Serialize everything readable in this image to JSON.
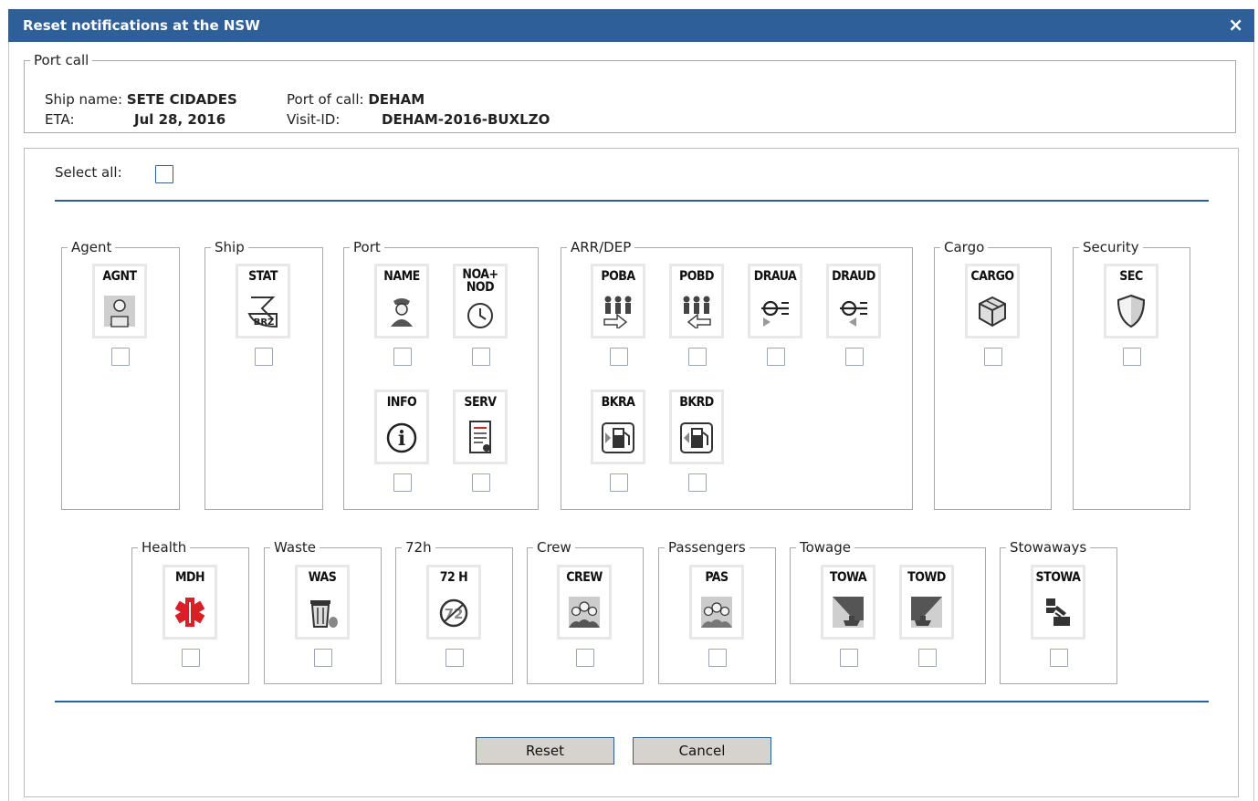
{
  "dialog": {
    "title": "Reset notifications at the NSW",
    "close": "×"
  },
  "port_call": {
    "legend": "Port call",
    "ship_name_label": "Ship name:",
    "ship_name": "SETE CIDADES",
    "eta_label": "ETA:",
    "eta": "Jul 28, 2016",
    "port_label": "Port of call:",
    "port": "DEHAM",
    "visit_label": "Visit-ID:",
    "visit": "DEHAM-2016-BUXLZO"
  },
  "select_all_label": "Select all:",
  "groups": {
    "agent": "Agent",
    "ship": "Ship",
    "port": "Port",
    "arrdep": "ARR/DEP",
    "cargo": "Cargo",
    "security": "Security",
    "health": "Health",
    "waste": "Waste",
    "h72": "72h",
    "crew": "Crew",
    "passengers": "Passengers",
    "towage": "Towage",
    "stowaways": "Stowaways"
  },
  "tiles": {
    "agnt": "AGNT",
    "stat": "STAT",
    "name": "NAME",
    "noa1": "NOA+",
    "noa2": "NOD",
    "info": "INFO",
    "serv": "SERV",
    "poba": "POBA",
    "pobd": "POBD",
    "draua": "DRAUA",
    "draud": "DRAUD",
    "bkra": "BKRA",
    "bkrd": "BKRD",
    "cargo": "CARGO",
    "sec": "SEC",
    "mdh": "MDH",
    "was": "WAS",
    "h72": "72 H",
    "crew": "CREW",
    "pas": "PAS",
    "towa": "TOWA",
    "towd": "TOWD",
    "stowa": "STOWA"
  },
  "icon_text": {
    "brz": "BRZ",
    "info_i": "i",
    "h72": "72"
  },
  "buttons": {
    "reset": "Reset",
    "cancel": "Cancel"
  },
  "colors": {
    "title_bar": "#2e5f99",
    "health_red": "#d92027"
  }
}
